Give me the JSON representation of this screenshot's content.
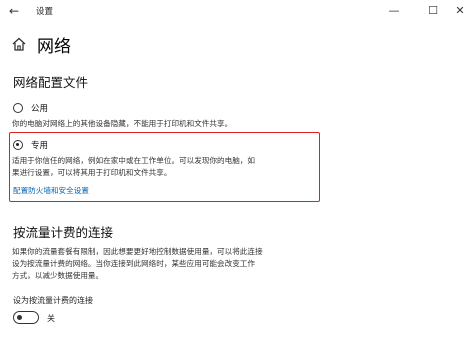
{
  "window": {
    "back_glyph": "←",
    "title": "设置",
    "controls": {
      "minimize": "—",
      "maximize": "☐",
      "close": "✕"
    }
  },
  "page": {
    "heading": "网络",
    "home_icon": "home-icon"
  },
  "network_profile": {
    "title": "网络配置文件",
    "options": [
      {
        "label": "公用",
        "selected": false,
        "description": [
          "你的电脑对网络上的其他设备隐藏，不能用于打印机和文件共享。"
        ]
      },
      {
        "label": "专用",
        "selected": true,
        "description": [
          "适用于你信任的网络，例如在家中或在工作单位。可以发现你的电脑，如",
          "果进行设置，可以将其用于打印机和文件共享。"
        ]
      }
    ],
    "firewall_link": "配置防火墙和安全设置"
  },
  "metered": {
    "title": "按流量计费的连接",
    "description": [
      "如果你的流量套餐有限制，因此想要更好地控制数据使用量，可以将此连接",
      "设为按流量计费的网络。当你连接到此网络时，某些应用可能会改变工作",
      "方式，以减少数据使用量。"
    ],
    "setting_label": "设为按流量计费的连接",
    "toggle_state": "关",
    "toggle_on": false
  },
  "colors": {
    "accent_link": "#0067b8",
    "highlight_border": "#e02020",
    "background": "#ffffff"
  }
}
